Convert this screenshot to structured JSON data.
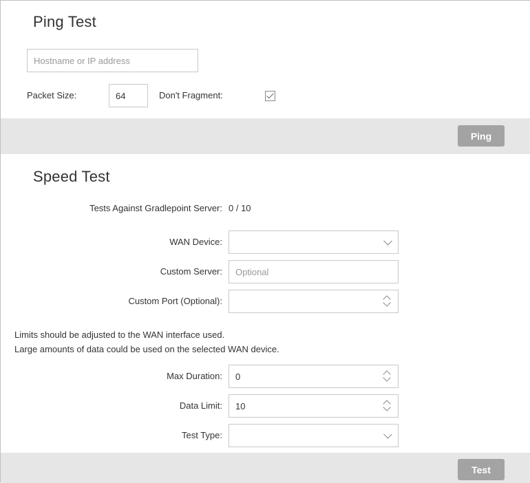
{
  "ping": {
    "title": "Ping Test",
    "host_placeholder": "Hostname or IP address",
    "packet_size_label": "Packet Size:",
    "packet_size_value": "64",
    "dont_fragment_label": "Don't Fragment:",
    "dont_fragment_checked": true,
    "button_label": "Ping"
  },
  "speed": {
    "title": "Speed Test",
    "tests_label": "Tests Against Gradlepoint Server:",
    "tests_value": "0 / 10",
    "wan_device_label": "WAN Device:",
    "wan_device_value": "",
    "custom_server_label": "Custom Server:",
    "custom_server_placeholder": "Optional",
    "custom_port_label": "Custom Port (Optional):",
    "custom_port_value": "",
    "notice_line1": "Limits should be adjusted to the WAN interface used.",
    "notice_line2": "Large amounts of data could be used on the selected WAN device.",
    "max_duration_label": "Max Duration:",
    "max_duration_value": "0",
    "data_limit_label": "Data Limit:",
    "data_limit_value": "10",
    "test_type_label": "Test Type:",
    "test_type_value": "",
    "button_label": "Test"
  },
  "icons": {
    "checkbox": "checkbox-checked-icon",
    "dropdown": "chevron-down-icon",
    "spinner": "spinner-updown-icon"
  },
  "colors": {
    "button_bg": "#a3a3a3",
    "bar_bg": "#e6e6e6",
    "border": "#c8c8c8"
  }
}
